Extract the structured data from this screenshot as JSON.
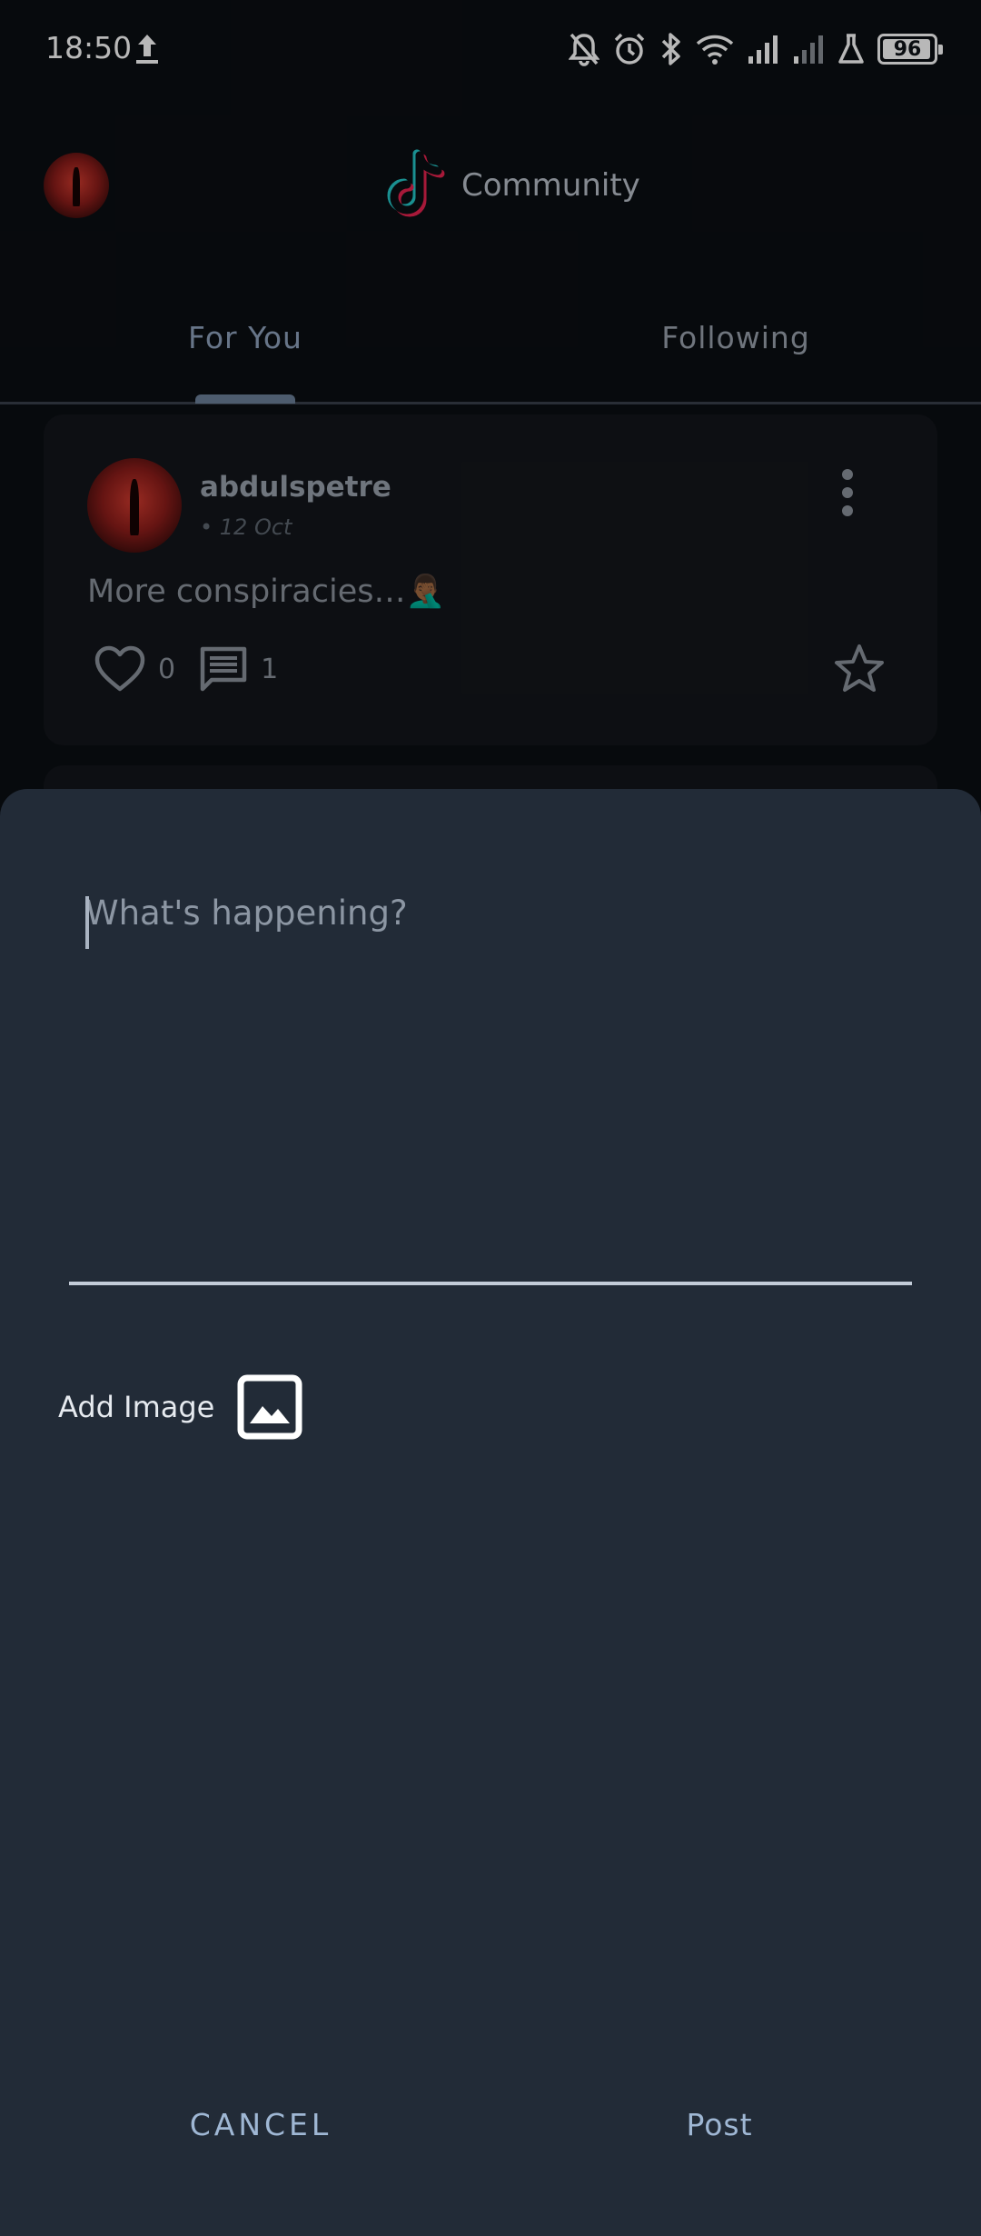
{
  "status_bar": {
    "time": "18:50",
    "battery_level": "96",
    "battery_fraction": 0.96,
    "icons": [
      "upload-icon",
      "bell-off-icon",
      "alarm-icon",
      "bluetooth-icon",
      "wifi-icon",
      "signal-full-icon",
      "signal-weak-icon",
      "flask-icon",
      "battery-icon"
    ]
  },
  "header": {
    "title": "Community",
    "logo": "tiktok-logo-icon"
  },
  "tabs": [
    {
      "label": "For You",
      "active": true
    },
    {
      "label": "Following",
      "active": false
    }
  ],
  "post": {
    "username": "abdulspetre",
    "date": "• 12 Oct",
    "text": "More conspiracies…🤦🏾‍♂️",
    "likes": "0",
    "comments": "1"
  },
  "composer": {
    "placeholder": "What's happening?",
    "value": "",
    "add_image_label": "Add Image",
    "cancel_label": "CANCEL",
    "post_label": "Post"
  },
  "colors": {
    "background": "#0b0e12",
    "sheet": "#222b37",
    "accent": "#9fb7d4",
    "tab_active": "#8fa3bd"
  }
}
